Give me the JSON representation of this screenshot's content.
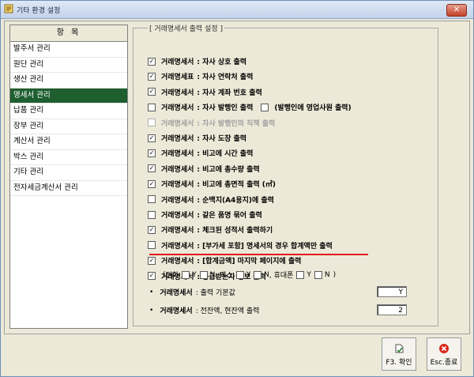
{
  "window": {
    "title": "기타 환경 설정",
    "close_label": "✕"
  },
  "sidebar": {
    "header": "항     목",
    "items": [
      {
        "label": "발주서 관리",
        "active": false
      },
      {
        "label": "원단 관리",
        "active": false
      },
      {
        "label": "생산 관리",
        "active": false
      },
      {
        "label": "명세서 관리",
        "active": true
      },
      {
        "label": "납품 관리",
        "active": false
      },
      {
        "label": "장부 관리",
        "active": false
      },
      {
        "label": "계산서 관리",
        "active": false
      },
      {
        "label": "박스 관리",
        "active": false
      },
      {
        "label": "기타 관리",
        "active": false
      },
      {
        "label": "전자세금계산서 관리",
        "active": false
      }
    ]
  },
  "settings": {
    "group_title": "[ 거래명세서 출력 설정 ]",
    "options": [
      {
        "label": "거래명세서",
        "text": ": 자사 상호 출력",
        "checked": true,
        "disabled": false
      },
      {
        "label": "거래명세표",
        "text": ": 자사 연락처 출력",
        "checked": true,
        "disabled": false
      },
      {
        "label": "거래명세서",
        "text": ": 자사 계좌 번호 출력",
        "checked": true,
        "disabled": false
      },
      {
        "label": "거래명세서",
        "text": ": 자사 발행인 출력",
        "checked": false,
        "disabled": false,
        "extra": "(발행인에 영업사원 출력)"
      },
      {
        "label": "거래명세서",
        "text": ": 자사 발행인의 직책 출력",
        "checked": false,
        "disabled": true
      },
      {
        "label": "거래명세서",
        "text": ": 자사 도장 출력",
        "checked": true,
        "disabled": false
      },
      {
        "label": "거래명세서",
        "text": ": 비고에 시간 출력",
        "checked": true,
        "disabled": false
      },
      {
        "label": "거래명세서",
        "text": ": 비고에 총수량 출력",
        "checked": true,
        "disabled": false
      },
      {
        "label": "거래명세서",
        "text": ": 비고에 총면적 출력 (㎡)",
        "checked": true,
        "disabled": false
      },
      {
        "label": "거래명세서",
        "text": ": 순백지(A4용지)에 출력",
        "checked": false,
        "disabled": false
      },
      {
        "label": "거래명세서",
        "text": ": 같은 품명 묶어 출력",
        "checked": false,
        "disabled": false
      },
      {
        "label": "거래명세서",
        "text": ": 체크된 성적서 출력하기",
        "checked": true,
        "disabled": false
      },
      {
        "label": "거래명세서",
        "text": ": [부가세 포함] 명세서의 경우 합계액만 출력",
        "checked": false,
        "disabled": false
      },
      {
        "label": "거래명세서",
        "text": ": [합계금액] 마지막 페이지에 출력",
        "checked": true,
        "disabled": false
      },
      {
        "label": "거래명세서",
        "text": ": 공급받는자 정보 출력",
        "checked": true,
        "disabled": false
      }
    ],
    "contact_line": {
      "open": "(",
      "phone": "전화",
      "fax": ", 팩스",
      "mobile": ", 휴대폰",
      "y": "Y",
      "n": "N",
      "close": ")"
    },
    "default_row": {
      "bullet": "•",
      "label": "거래명세서",
      "text": ": 출력 기본값",
      "value": "Y"
    },
    "amount_row": {
      "bullet": "•",
      "label": "거래명세서",
      "text": ": 전잔액, 현잔액 출력",
      "value": "2"
    }
  },
  "buttons": {
    "confirm": "F3. 확인",
    "close": "Esc.종료"
  },
  "colors": {
    "active_item": "#1f5e2f",
    "highlight_line": "#e0161b"
  }
}
